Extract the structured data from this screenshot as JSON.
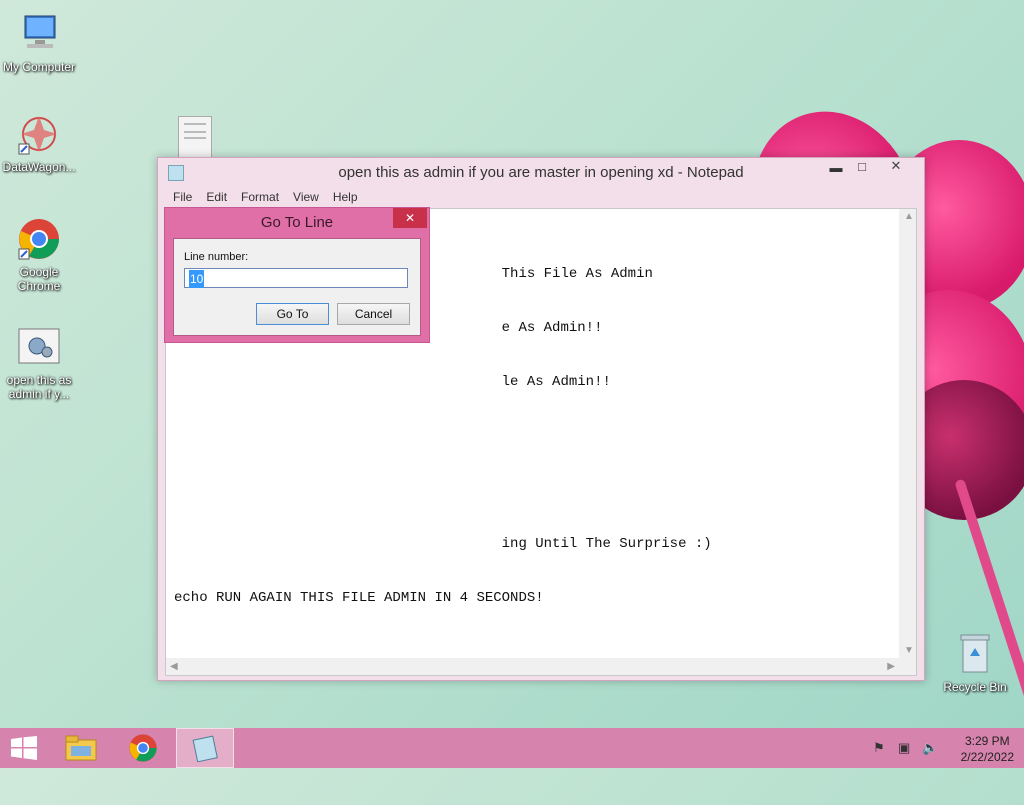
{
  "desktop": {
    "icons": [
      {
        "label": "My Computer",
        "icon": "computer-icon"
      },
      {
        "label": "DataWagon...",
        "icon": "datawagon-icon"
      },
      {
        "label": "Google Chrome",
        "icon": "chrome-icon"
      },
      {
        "label": "open this as admin if y...",
        "icon": "batch-file-icon"
      },
      {
        "label": "Recycle Bin",
        "icon": "recycle-bin-icon"
      }
    ]
  },
  "notepad": {
    "title": "open this as admin if you are master in opening xd - Notepad",
    "menu": [
      "File",
      "Edit",
      "Format",
      "View",
      "Help"
    ],
    "lines": [
      "                                       This File As Admin",
      "                                       e As Admin!!",
      "                                       le As Admin!!",
      "",
      "",
      "                                       ing Until The Surprise :)",
      "echo RUN AGAIN THIS FILE ADMIN IN 4 SECONDS!",
      "",
      "",
      "□□□□□□□□"
    ]
  },
  "goto_dialog": {
    "title": "Go To Line",
    "close_label": "✕",
    "line_number_label": "Line number:",
    "line_number_value": "10",
    "goto_label": "Go To",
    "cancel_label": "Cancel"
  },
  "taskbar": {
    "time": "3:29 PM",
    "date": "2/22/2022",
    "items": [
      "start",
      "file-explorer",
      "chrome",
      "notepad"
    ]
  },
  "colors": {
    "accent": "#d683ad",
    "dialog_frame": "#e06fa7",
    "close_red": "#c9304a"
  }
}
